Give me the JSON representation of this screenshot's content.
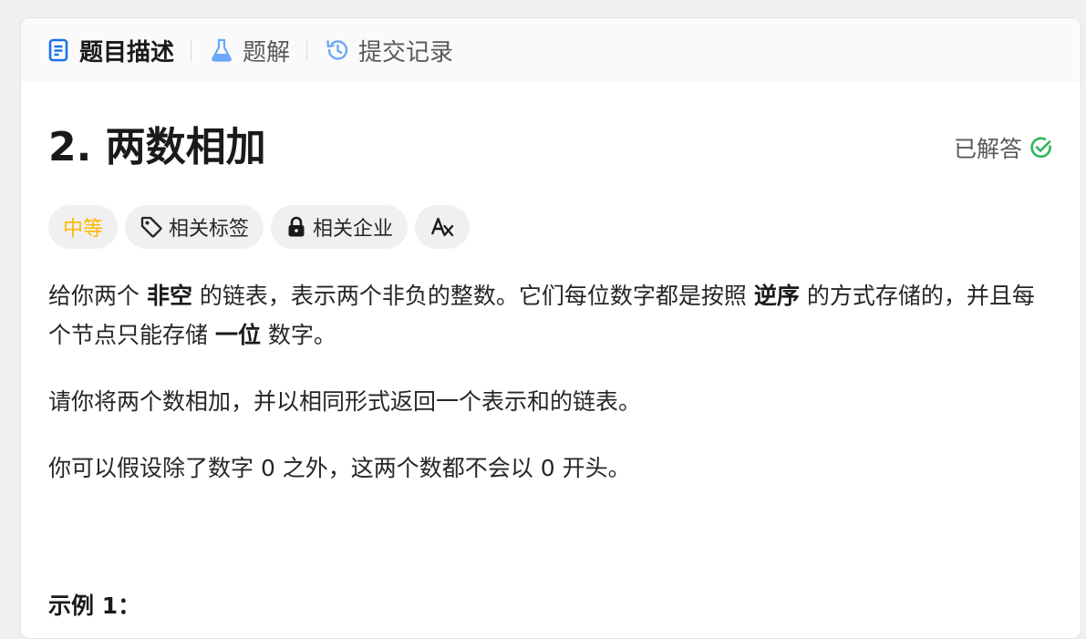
{
  "tabs": [
    {
      "label": "题目描述",
      "icon": "description-icon",
      "active": true
    },
    {
      "label": "题解",
      "icon": "flask-icon",
      "active": false
    },
    {
      "label": "提交记录",
      "icon": "history-icon",
      "active": false
    }
  ],
  "problem": {
    "title": "2. 两数相加",
    "status": "已解答",
    "status_color": "#2db55d"
  },
  "tags": {
    "difficulty": "中等",
    "difficulty_color": "#ffb800",
    "related_topics": "相关标签",
    "related_companies": "相关企业",
    "translate_icon": "translate-icon"
  },
  "description": {
    "p1_a": "给你两个 ",
    "p1_b1": "非空",
    "p1_c": " 的链表，表示两个非负的整数。它们每位数字都是按照 ",
    "p1_b2": "逆序",
    "p1_d": " 的方式存储的，并且每个节点只能存储 ",
    "p1_b3": "一位",
    "p1_e": " 数字。",
    "p2": "请你将两个数相加，并以相同形式返回一个表示和的链表。",
    "p3": "你可以假设除了数字 0 之外，这两个数都不会以 0 开头。"
  },
  "example_heading": "示例 1："
}
